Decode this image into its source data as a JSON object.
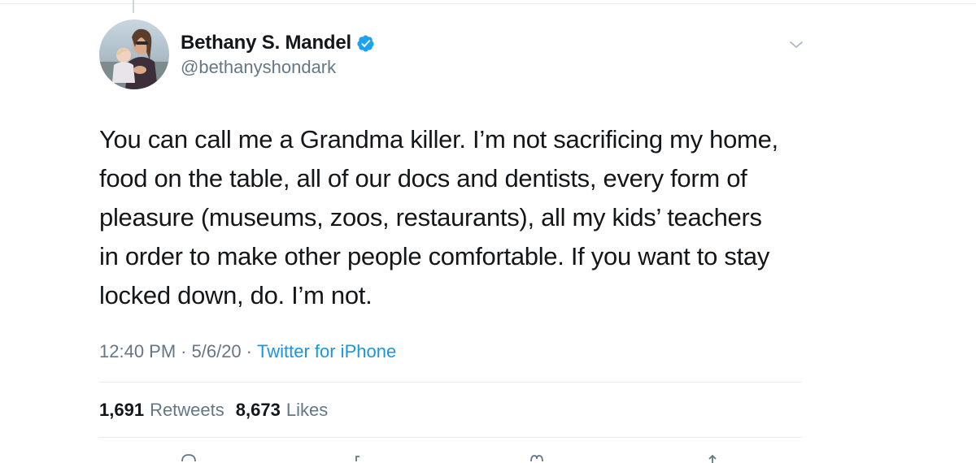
{
  "tweet": {
    "author": {
      "display_name": "Bethany S. Mandel",
      "handle": "@bethanyshondark",
      "verified": true
    },
    "text_lines": [
      "You can call me a Grandma killer. I’m not sacrificing my home,",
      "food on the table, all of our docs and dentists, every form of",
      "pleasure (museums, zoos, restaurants), all my kids’ teachers",
      "in order to make other people comfortable. If you want to stay",
      "locked down, do. I’m not."
    ],
    "time": "12:40 PM",
    "separator": "·",
    "date": "5/6/20",
    "source": "Twitter for iPhone",
    "stats": {
      "retweets_count": "1,691",
      "retweets_label": "Retweets",
      "likes_count": "8,673",
      "likes_label": "Likes"
    }
  },
  "icons": {
    "verified": "verified-badge-icon",
    "menu": "chevron-down-icon",
    "actions": [
      "reply-icon",
      "retweet-icon",
      "like-icon",
      "share-icon"
    ]
  },
  "colors": {
    "text_primary": "#14171a",
    "text_secondary": "#657786",
    "link": "#1b95e0",
    "verified": "#1da1f2",
    "border": "#e6ecf0"
  }
}
